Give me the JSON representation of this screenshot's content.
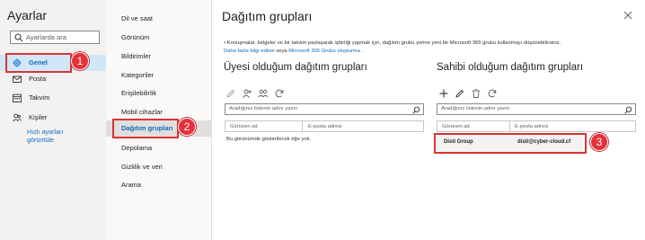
{
  "left_nav": {
    "title": "Ayarlar",
    "search_placeholder": "Ayarlarda ara",
    "items": [
      {
        "label": "Genel",
        "icon": "gear-icon",
        "selected": true
      },
      {
        "label": "Posta",
        "icon": "mail-icon"
      },
      {
        "label": "Takvim",
        "icon": "calendar-icon"
      },
      {
        "label": "Kişiler",
        "icon": "people-icon"
      }
    ],
    "quick_settings_link": "Hızlı ayarları görüntüle"
  },
  "categories": {
    "items": [
      {
        "label": "Dil ve saat"
      },
      {
        "label": "Görünüm"
      },
      {
        "label": "Bildirimler"
      },
      {
        "label": "Kategoriler"
      },
      {
        "label": "Erişilebilirlik"
      },
      {
        "label": "Mobil cihazlar"
      },
      {
        "label": "Dağıtım grupları",
        "selected": true
      },
      {
        "label": "Depolama"
      },
      {
        "label": "Gizlilik ve veri"
      },
      {
        "label": "Arama"
      }
    ]
  },
  "main": {
    "title": "Dağıtım grupları",
    "description": "Konuşmalar, belgeler ve bir takvim paylaşarak işbirliği yapmak için, dağıtım grubu yerine yeni bir Microsoft 365 grubu kullanmayı düşünebilirsiniz.",
    "learn_more_link": "Daha fazla bilgi edinin",
    "connector": "veya",
    "create_group_link": "Microsoft 365 Grubu oluşturma",
    "trailing": ".",
    "member_section": {
      "title": "Üyesi olduğum dağıtım grupları",
      "search_placeholder": "Aradığınız listenin adını yazın",
      "col_display_name": "Görünen ad",
      "col_email": "E-posta adresi",
      "empty_message": "Bu görünümde gösterilecek öğe yok."
    },
    "owner_section": {
      "title": "Sahibi olduğum dağıtım grupları",
      "search_placeholder": "Aradığınız listenin adını yazın",
      "col_display_name": "Görünen ad",
      "col_email": "E-posta adresi",
      "rows": [
        {
          "name": "Disti Group",
          "email": "disti@cyber-cloud.cf"
        }
      ]
    }
  },
  "annotations": {
    "badge_1": "1",
    "badge_2": "2",
    "badge_3": "3",
    "color": "#e5323a"
  },
  "colors": {
    "accent": "#0f6cbd",
    "selected_bg": "#d0e7f8"
  }
}
